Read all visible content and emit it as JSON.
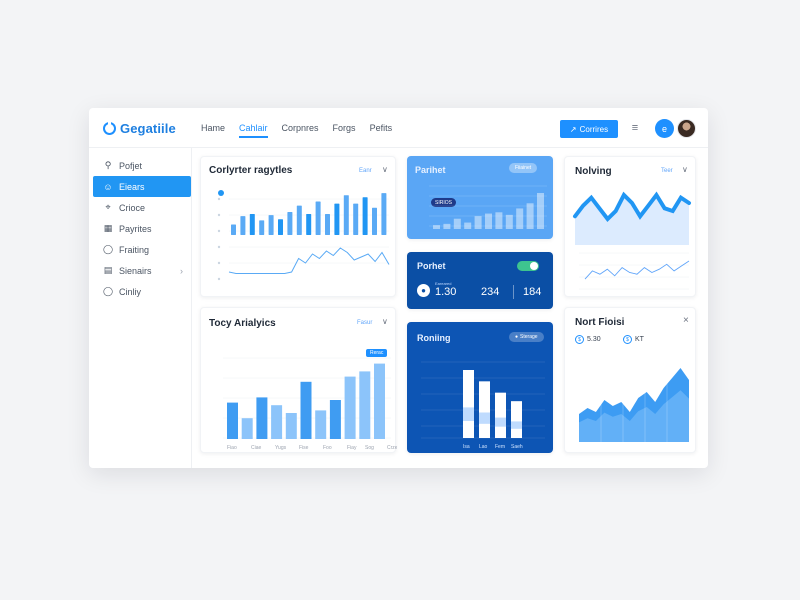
{
  "header": {
    "logo_text": "Gegatiile",
    "nav": [
      "Hame",
      "Cahlair",
      "Corpnres",
      "Forgs",
      "Pefits"
    ],
    "cta_label": "Corrires",
    "cta_icon": "arrow-icon",
    "menu_icon": "list-icon",
    "circle_icon_label": "e"
  },
  "sidebar": {
    "items": [
      {
        "label": "Pofjet",
        "icon": "search-icon"
      },
      {
        "label": "Eiears",
        "icon": "users-icon",
        "active": true
      },
      {
        "label": "Crioce",
        "icon": "pin-icon"
      },
      {
        "label": "Payrites",
        "icon": "card-icon"
      },
      {
        "label": "Fraiting",
        "icon": "bolt-icon"
      },
      {
        "label": "Sienairs",
        "icon": "layers-icon",
        "has_chevron": true
      },
      {
        "label": "Cinliy",
        "icon": "help-icon"
      }
    ]
  },
  "cards": {
    "top_left": {
      "title": "Corlyrter ragytles",
      "control": "Eanr",
      "chevron": "∨"
    },
    "blue_top": {
      "title": "Parihet",
      "pill": "Fiiainet",
      "pill_tooltip": "SIRIOS"
    },
    "navy_mid": {
      "title": "Porhet",
      "stat1": "1.30",
      "stat2": "234",
      "stat3": "184",
      "stat1_label": "Eareared"
    },
    "navy_bottom": {
      "title": "Roniing",
      "pill": "Sterage"
    },
    "right_top": {
      "title": "Nolving",
      "control": "Teer",
      "chevron": "∨"
    },
    "right_bottom": {
      "title": "Nort Fioisi",
      "close": "×",
      "stat1": "5.30",
      "stat2": "KT"
    },
    "bottom_left": {
      "title": "Tocy Arialyics",
      "control": "Fasur",
      "chevron": "∨",
      "badge": "Rerac"
    }
  },
  "chart_data": [
    {
      "type": "bar",
      "id": "top-left-bars",
      "values": [
        10,
        18,
        20,
        14,
        19,
        15,
        22,
        28,
        20,
        32,
        20,
        30,
        38,
        30,
        36,
        26,
        40
      ]
    },
    {
      "type": "line",
      "id": "top-left-line",
      "values": [
        6,
        5,
        5,
        5,
        5,
        5,
        5,
        5,
        5,
        6,
        15,
        12,
        18,
        15,
        20,
        17,
        22,
        19,
        14,
        16,
        18,
        13,
        19,
        11
      ]
    },
    {
      "type": "bar",
      "id": "blue-card-bars",
      "values": [
        3,
        4,
        8,
        5,
        10,
        12,
        13,
        11,
        16,
        20,
        28
      ]
    },
    {
      "type": "area",
      "id": "moving-wave",
      "values": [
        14,
        22,
        28,
        20,
        12,
        18,
        30,
        24,
        14,
        22,
        30,
        20,
        18,
        28,
        24
      ]
    },
    {
      "type": "line",
      "id": "moving-line",
      "values": [
        6,
        11,
        9,
        12,
        8,
        13,
        10,
        9,
        13,
        10,
        12,
        15,
        11,
        14,
        17
      ]
    },
    {
      "type": "bar",
      "id": "analytics-bars",
      "categories": [
        "Fiao",
        "Ciae",
        "Yugs",
        "Fise",
        "Foo",
        "Fiay",
        "Sog",
        "Crzeoc"
      ],
      "values": [
        28,
        16,
        32,
        26,
        20,
        44,
        22,
        30,
        48,
        52,
        58
      ]
    },
    {
      "type": "bar",
      "id": "ranking-bars",
      "categories": [
        "Isa",
        "Lao",
        "Fem",
        "Saeh"
      ],
      "values": [
        48,
        40,
        32,
        26
      ]
    },
    {
      "type": "area",
      "id": "nort-area",
      "values": [
        28,
        34,
        30,
        42,
        36,
        40,
        30,
        44,
        50,
        40,
        54,
        64,
        74,
        62
      ]
    }
  ]
}
